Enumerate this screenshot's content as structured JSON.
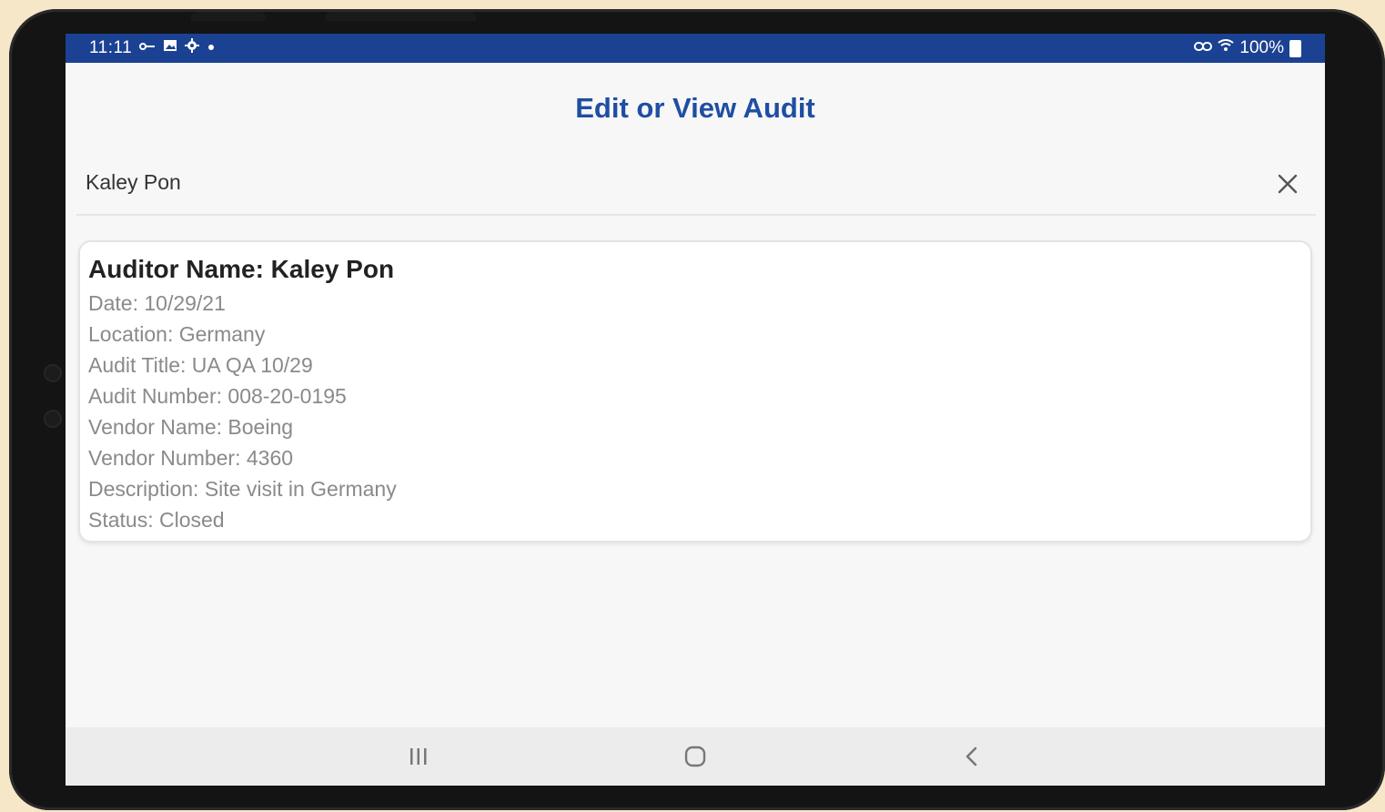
{
  "status_bar": {
    "time": "11:11",
    "battery": "100%"
  },
  "page": {
    "title": "Edit or View Audit"
  },
  "search": {
    "value": "Kaley Pon"
  },
  "audit": {
    "heading": "Auditor Name: Kaley Pon",
    "lines": [
      "Date: 10/29/21",
      "Location: Germany",
      "Audit Title: UA QA 10/29",
      "Audit Number: 008-20-0195",
      "Vendor Name: Boeing",
      "Vendor Number: 4360",
      "Description: Site visit in Germany",
      "Status: Closed"
    ]
  },
  "colors": {
    "status_bar": "#1b4193",
    "title": "#1f4ea3"
  },
  "icons": {
    "clear": "close-icon",
    "recents": "recent-apps-icon",
    "home": "home-icon",
    "back": "back-icon"
  }
}
